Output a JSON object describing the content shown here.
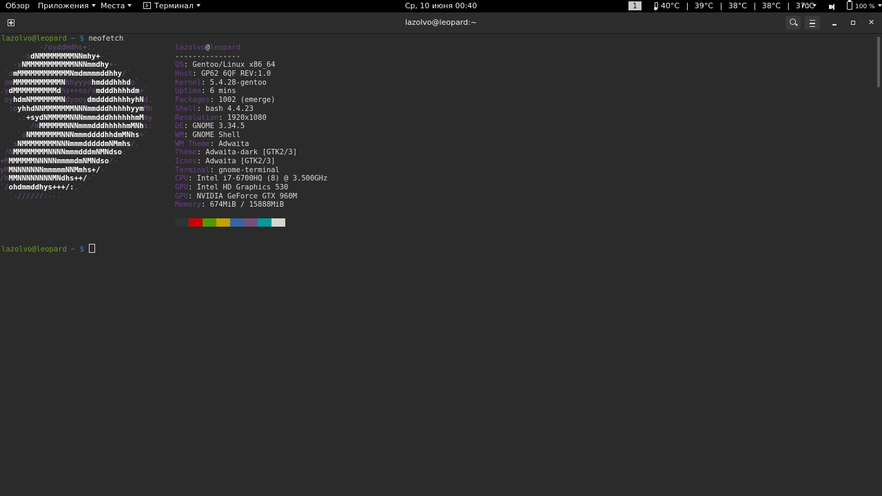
{
  "topbar": {
    "overview": "Обзор",
    "applications": "Приложения",
    "places": "Места",
    "terminal_app": "Терминал",
    "clock": "Ср, 10 июня  00:40",
    "workspace": "1",
    "temps": [
      "40°C",
      "39°C",
      "38°C",
      "38°C",
      "37°C"
    ],
    "keyboard_layout": "ru",
    "battery": "100 %"
  },
  "header": {
    "title": "lazolvo@leopard:~"
  },
  "terminal": {
    "prompt_user": "lazolvo@leopard",
    "prompt_path": " ~ ",
    "prompt_sign": "$ ",
    "command": "neofetch",
    "ascii_art": [
      [
        {
          "d": "         -/oyddmdhs+:.",
          "c": "ad"
        }
      ],
      [
        {
          "d": "     -o",
          "c": "ad"
        },
        {
          "d": "dNMMMMMMMMNNmhy+",
          "c": "ab"
        },
        {
          "d": "-`",
          "c": "ad"
        }
      ],
      [
        {
          "d": "   -y",
          "c": "ad"
        },
        {
          "d": "NMMMMMMMMMMMNNNmmdhy",
          "c": "ab"
        },
        {
          "d": "+-",
          "c": "ad"
        }
      ],
      [
        {
          "d": " `o",
          "c": "ad"
        },
        {
          "d": "mMMMMMMMMMMMMNmdmmmmddhhy",
          "c": "ab"
        },
        {
          "d": "/`",
          "c": "ad"
        }
      ],
      [
        {
          "d": " om",
          "c": "ad"
        },
        {
          "d": "MMMMMMMMMMMN",
          "c": "ab"
        },
        {
          "d": "hhyyyo",
          "c": "ad"
        },
        {
          "d": "hmdddhhhd",
          "c": "ab"
        },
        {
          "d": "o`",
          "c": "ad"
        }
      ],
      [
        {
          "d": ".y",
          "c": "ad"
        },
        {
          "d": "dMMMMMMMMMMd",
          "c": "ab"
        },
        {
          "d": "hs++so/s",
          "c": "ad"
        },
        {
          "d": "mdddhhhhdm",
          "c": "ab"
        },
        {
          "d": "+`",
          "c": "ad"
        }
      ],
      [
        {
          "d": " oy",
          "c": "ad"
        },
        {
          "d": "hdmNMMMMMMMN",
          "c": "ab"
        },
        {
          "d": "dyooy",
          "c": "ad"
        },
        {
          "d": "dmddddhhhhyhN",
          "c": "ab"
        },
        {
          "d": "d.",
          "c": "ad"
        }
      ],
      [
        {
          "d": "  :o",
          "c": "ad"
        },
        {
          "d": "yhhdNNMMMMMMMNNNmmdddhhhhhyym",
          "c": "ab"
        },
        {
          "d": "Mh",
          "c": "ad"
        }
      ],
      [
        {
          "d": "    .:",
          "c": "ad"
        },
        {
          "d": "+sydNMMMMMNNNmmmdddhhhhhhmM",
          "c": "ab"
        },
        {
          "d": "my",
          "c": "ad"
        }
      ],
      [
        {
          "d": "       /m",
          "c": "ad"
        },
        {
          "d": "MMMMMMNNNmmmdddhhhhhmMNh",
          "c": "ab"
        },
        {
          "d": "s:",
          "c": "ad"
        }
      ],
      [
        {
          "d": "    `o",
          "c": "ad"
        },
        {
          "d": "NMMMMMMMNNNmmmddddhhdmMNhs",
          "c": "ab"
        },
        {
          "d": "+`",
          "c": "ad"
        }
      ],
      [
        {
          "d": "  `s",
          "c": "ad"
        },
        {
          "d": "NMMMMMMMMNNNmmmdddddmNMmhs",
          "c": "ab"
        },
        {
          "d": "/.",
          "c": "ad"
        }
      ],
      [
        {
          "d": " /N",
          "c": "ad"
        },
        {
          "d": "MMMMMMMMNNNNmmmdddmNMNdso",
          "c": "ab"
        },
        {
          "d": ":`",
          "c": "ad"
        }
      ],
      [
        {
          "d": "+M",
          "c": "ad"
        },
        {
          "d": "MMMMMMNNNNNmmmmdmNMNdso",
          "c": "ab"
        },
        {
          "d": "/-",
          "c": "ad"
        }
      ],
      [
        {
          "d": "yM",
          "c": "ad"
        },
        {
          "d": "MNNNNNNNmmmmmNNMmhs+/",
          "c": "ab"
        },
        {
          "d": "-`",
          "c": "ad"
        }
      ],
      [
        {
          "d": "/h",
          "c": "ad"
        },
        {
          "d": "MMNNNNNNNNMNdhs++/",
          "c": "ab"
        },
        {
          "d": "-`",
          "c": "ad"
        }
      ],
      [
        {
          "d": "`/",
          "c": "ad"
        },
        {
          "d": "ohdmmddhys+++/:",
          "c": "ab"
        },
        {
          "d": ".`",
          "c": "ad"
        }
      ],
      [
        {
          "d": "  `-//////:--.",
          "c": "ad"
        }
      ]
    ],
    "info_user": "lazolvo",
    "info_at": "@",
    "info_host": "leopard",
    "info_separator": "---------------",
    "info": [
      {
        "key": "OS",
        "value": "Gentoo/Linux x86_64"
      },
      {
        "key": "Host",
        "value": "GP62 6QF REV:1.0"
      },
      {
        "key": "Kernel",
        "value": "5.4.28-gentoo"
      },
      {
        "key": "Uptime",
        "value": "6 mins"
      },
      {
        "key": "Packages",
        "value": "1002 (emerge)"
      },
      {
        "key": "Shell",
        "value": "bash 4.4.23"
      },
      {
        "key": "Resolution",
        "value": "1920x1080"
      },
      {
        "key": "DE",
        "value": "GNOME 3.34.5"
      },
      {
        "key": "WM",
        "value": "GNOME Shell"
      },
      {
        "key": "WM Theme",
        "value": "Adwaita"
      },
      {
        "key": "Theme",
        "value": "Adwaita-dark [GTK2/3]"
      },
      {
        "key": "Icons",
        "value": "Adwaita [GTK2/3]"
      },
      {
        "key": "Terminal",
        "value": "gnome-terminal"
      },
      {
        "key": "CPU",
        "value": "Intel i7-6700HQ (8) @ 3.500GHz"
      },
      {
        "key": "GPU",
        "value": "Intel HD Graphics 530"
      },
      {
        "key": "GPU",
        "value": "NVIDIA GeForce GTX 960M"
      },
      {
        "key": "Memory",
        "value": "674MiB / 15888MiB"
      }
    ],
    "palette": [
      "#2e3436",
      "#cc0000",
      "#4e9a06",
      "#c4a000",
      "#3465a4",
      "#75507b",
      "#06989a",
      "#d3d7cf"
    ]
  },
  "colors": {
    "prompt_green": "#6a9b23",
    "info_purple": "#6d3e8c",
    "background": "#2b2b2b"
  }
}
